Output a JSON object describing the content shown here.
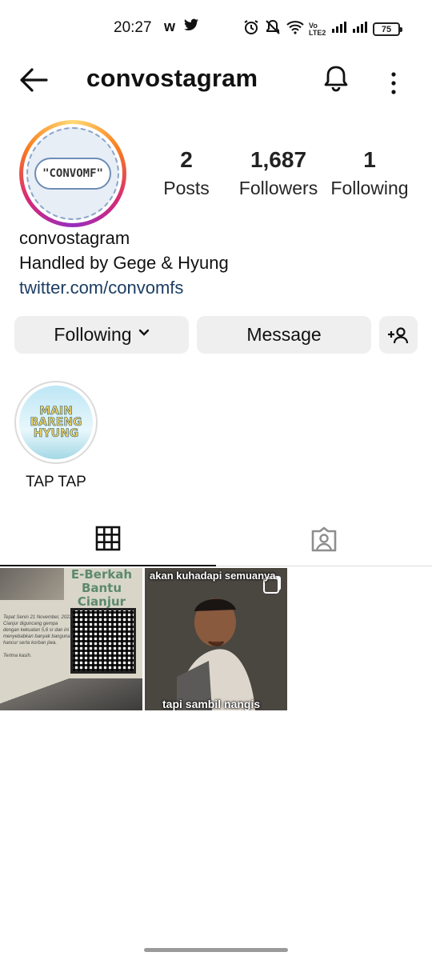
{
  "status_bar": {
    "time": "20:27",
    "app_icons": [
      "w",
      "twitter-icon"
    ],
    "network": "Vo LTE2",
    "battery": "75"
  },
  "header": {
    "username": "convostagram"
  },
  "profile": {
    "avatar_text": "\"CONVOMF\"",
    "stats": {
      "posts_count": "2",
      "posts_label": "Posts",
      "followers_count": "1,687",
      "followers_label": "Followers",
      "following_count": "1",
      "following_label": "Following"
    },
    "name": "convostagram",
    "bio": "Handled by Gege & Hyung",
    "link": "twitter.com/convomfs"
  },
  "actions": {
    "following_label": "Following",
    "message_label": "Message"
  },
  "highlights": [
    {
      "cover_text": "MAIN BARENG HYUNG",
      "label": "TAP TAP"
    }
  ],
  "tabs": [
    "grid-icon",
    "tagged-icon"
  ],
  "posts": [
    {
      "title": "E-Berkah Bantu Cianjur",
      "body": "Tepat Senin 21 November, 2022. Cianjur diguncang gempa dengan kekuatan 5,6 sr dan ini menyebabkan banyak bangunan hancur serta korban jiwa.",
      "footer": "Terima kasih."
    },
    {
      "top_caption": "akan kuhadapi semuanya",
      "bottom_caption": "tapi sambil nangis"
    }
  ]
}
